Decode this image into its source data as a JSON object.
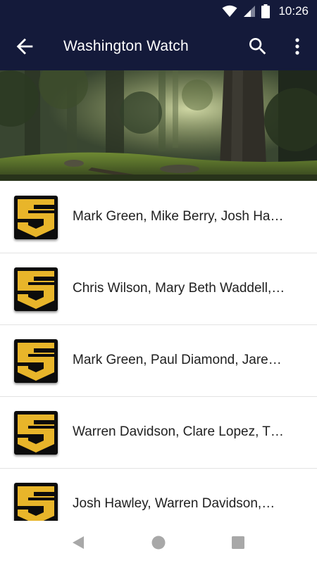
{
  "status_bar": {
    "time": "10:26",
    "icons": [
      "wifi-icon",
      "cell-signal-icon",
      "battery-icon"
    ]
  },
  "app_bar": {
    "title": "Washington Watch",
    "background_color": "#141a3a",
    "icons": [
      "arrow-back-icon",
      "search-icon",
      "more-vert-icon"
    ]
  },
  "hero": {
    "description_icon": "forest-banner-image"
  },
  "list": {
    "logo_colors": {
      "gold": "#e8b52a",
      "black": "#0c0c0c"
    },
    "items": [
      {
        "title": "Mark Green, Mike Berry, Josh Ha…"
      },
      {
        "title": "Chris Wilson, Mary Beth Waddell,…"
      },
      {
        "title": "Mark Green, Paul Diamond, Jare…"
      },
      {
        "title": "Warren Davidson, Clare Lopez, T…"
      },
      {
        "title": "Josh Hawley, Warren Davidson,…"
      }
    ]
  },
  "nav_bar": {
    "icons": [
      "nav-back-icon",
      "nav-home-icon",
      "nav-recents-icon"
    ]
  }
}
